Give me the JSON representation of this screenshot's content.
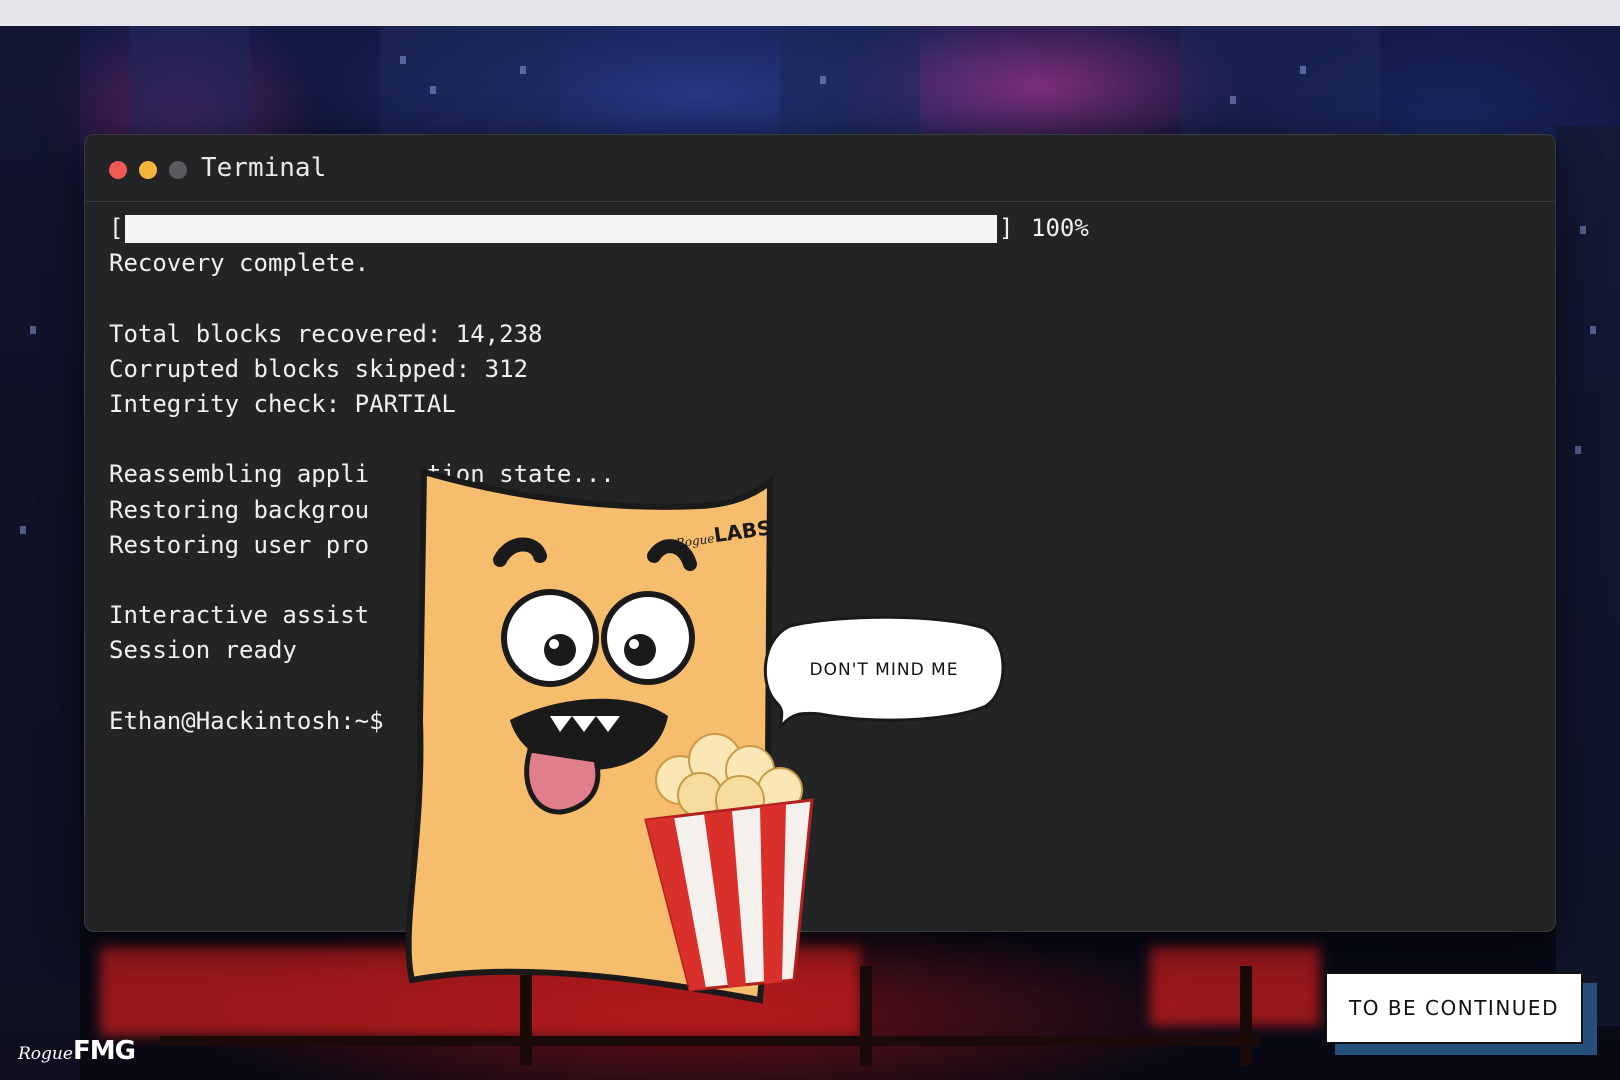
{
  "window": {
    "title": "Terminal"
  },
  "terminal": {
    "progress": {
      "fraction": 1.0,
      "percent_label": "100%",
      "open_bracket": "[",
      "close_bracket": "]"
    },
    "lines": [
      "Recovery complete.",
      "",
      "Total blocks recovered: 14,238",
      "Corrupted blocks skipped: 312",
      "Integrity check: PARTIAL",
      "",
      "Reassembling appli    tion state...",
      "Restoring backgrou",
      "Restoring user pro",
      "",
      "Interactive assist",
      "Session ready",
      "",
      "Ethan@Hackintosh:~$"
    ]
  },
  "overlay": {
    "speech_bubble": "DON'T MIND ME",
    "mascot_logo_small": "Rogue",
    "mascot_logo_big": "LABS",
    "to_be_continued": "TO BE CONTINUED",
    "corner_logo_small": "Rogue",
    "corner_logo_big": "FMG"
  },
  "colors": {
    "terminal_bg": "#232426",
    "close": "#ef5a55",
    "minimize": "#f2b43a",
    "maximize": "#5a5b5e",
    "mascot": "#f5bd6c"
  }
}
